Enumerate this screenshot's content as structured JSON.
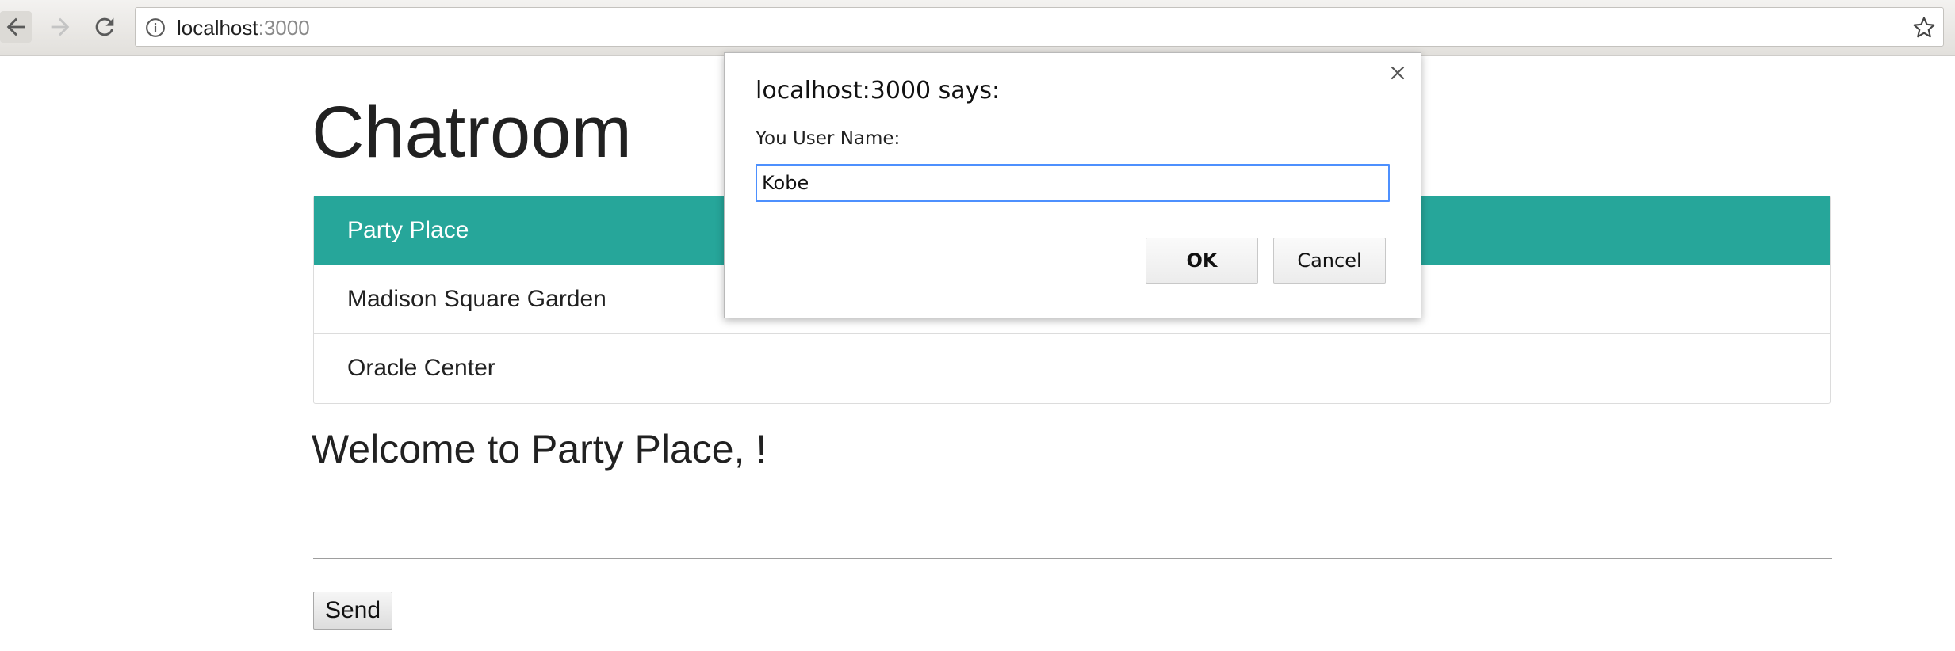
{
  "browser": {
    "url_host": "localhost",
    "url_port": ":3000"
  },
  "page": {
    "title": "Chatroom",
    "rooms": [
      {
        "label": "Party Place",
        "active": true
      },
      {
        "label": "Madison Square Garden",
        "active": false
      },
      {
        "label": "Oracle Center",
        "active": false
      }
    ],
    "welcome": "Welcome to Party Place, !",
    "message_value": "",
    "send_label": "Send",
    "accent_color": "#26a69a"
  },
  "dialog": {
    "title": "localhost:3000 says:",
    "message": "You User Name:",
    "input_value": "Kobe",
    "ok_label": "OK",
    "cancel_label": "Cancel",
    "close_icon": "close-icon"
  },
  "icons": {
    "back": "back-arrow-icon",
    "forward": "forward-arrow-icon",
    "reload": "reload-icon",
    "info": "info-icon",
    "bookmark": "star-icon"
  }
}
